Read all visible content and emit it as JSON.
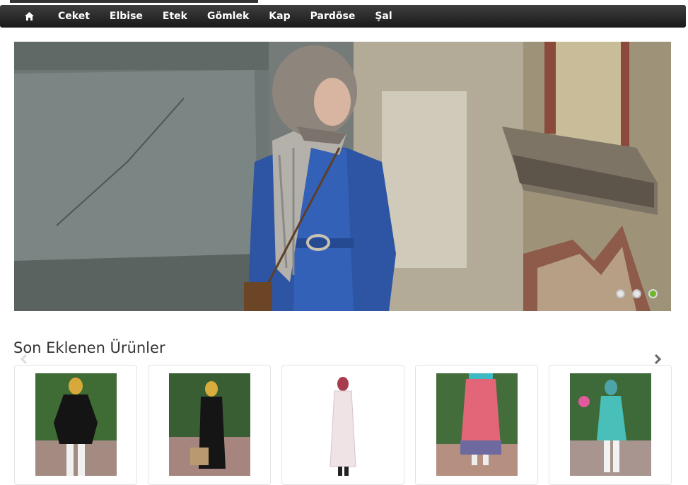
{
  "nav": {
    "home_icon": "home-icon",
    "items": [
      "Ceket",
      "Elbise",
      "Etek",
      "Gömlek",
      "Kap",
      "Pardöse",
      "Şal"
    ]
  },
  "slider": {
    "slide_count": 3,
    "active_index": 2,
    "dot_colors": {
      "inactive": "#e6e6e6",
      "active": "#6fb52c"
    }
  },
  "section": {
    "title": "Son Eklenen Ürünler",
    "prev_icon": "chevron-left-icon",
    "next_icon": "chevron-right-icon"
  },
  "products": [
    {
      "image": "woman in black belted tunic, yellow headscarf, garden"
    },
    {
      "image": "woman in black dress with belt, handbag, garden"
    },
    {
      "image": "woman in light pink long coat, white background"
    },
    {
      "image": "pink striped long skirt, garden path"
    },
    {
      "image": "woman in turquoise tunic, white trousers, garden"
    }
  ],
  "colors": {
    "nav_bg": "#222222",
    "nav_text": "#ffffff",
    "title_text": "#333333",
    "card_border": "#e3e3e3"
  }
}
